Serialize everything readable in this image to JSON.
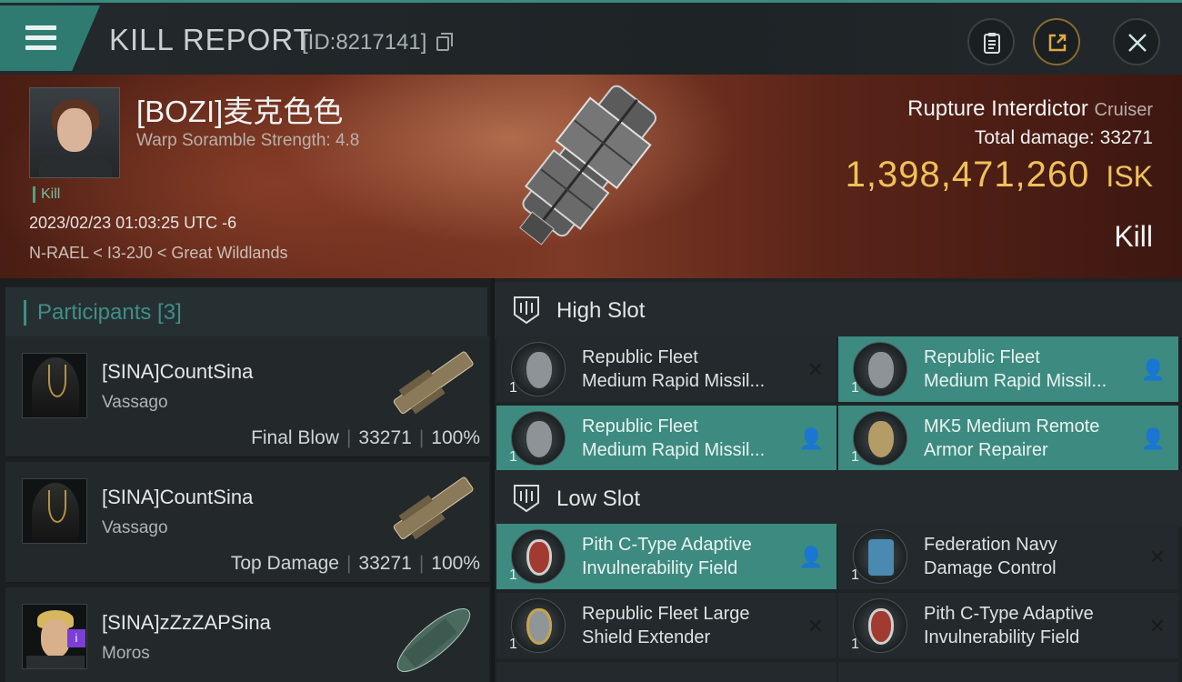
{
  "header": {
    "title": "KILL REPORT",
    "report_id": "[ID:8217141]",
    "icons": [
      "menu-icon",
      "copy-icon",
      "clipboard-icon",
      "share-icon",
      "close-icon"
    ]
  },
  "victim": {
    "name": "[BOZI]麦克色色",
    "warp_scramble": "Warp Soramble Strength: 4.8",
    "tag": "Kill",
    "datetime": "2023/02/23 01:03:25 UTC -6",
    "location": "N-RAEL < I3-2J0 < Great Wildlands",
    "ship_name": "Rupture Interdictor",
    "ship_class": "Cruiser",
    "total_damage_label": "Total damage:",
    "total_damage": "33271",
    "isk_value": "1,398,471,260",
    "isk_unit": "ISK",
    "result": "Kill"
  },
  "participants": {
    "title": "Participants [3]",
    "list": [
      {
        "name": "[SINA]CountSina",
        "ship": "Vassago",
        "role": "Final Blow",
        "damage": "33271",
        "percent": "100%"
      },
      {
        "name": "[SINA]CountSina",
        "ship": "Vassago",
        "role": "Top Damage",
        "damage": "33271",
        "percent": "100%"
      },
      {
        "name": "[SINA]zZzZAPSina",
        "ship": "Moros",
        "role": "",
        "damage": "",
        "percent": ""
      }
    ]
  },
  "slots": {
    "high": {
      "title": "High Slot",
      "modules": [
        {
          "name": "Republic Fleet\nMedium Rapid Missil...",
          "qty": "1",
          "status": "destroyed",
          "flag_icon": "x-icon"
        },
        {
          "name": "Republic Fleet\nMedium Rapid Missil...",
          "qty": "1",
          "status": "dropped",
          "flag_icon": "person-icon"
        },
        {
          "name": "Republic Fleet\nMedium Rapid Missil...",
          "qty": "1",
          "status": "dropped",
          "flag_icon": "person-icon"
        },
        {
          "name": "MK5 Medium Remote\nArmor Repairer",
          "qty": "1",
          "status": "dropped",
          "flag_icon": "person-icon"
        }
      ]
    },
    "low": {
      "title": "Low Slot",
      "modules": [
        {
          "name": "Pith C-Type Adaptive\nInvulnerability Field",
          "qty": "1",
          "status": "dropped",
          "flag_icon": "person-icon"
        },
        {
          "name": "Federation Navy\nDamage Control",
          "qty": "1",
          "status": "destroyed",
          "flag_icon": "x-icon"
        },
        {
          "name": "Republic Fleet Large\nShield Extender",
          "qty": "1",
          "status": "destroyed",
          "flag_icon": "x-icon"
        },
        {
          "name": "Pith C-Type Adaptive\nInvulnerability Field",
          "qty": "1",
          "status": "destroyed",
          "flag_icon": "x-icon"
        }
      ]
    }
  },
  "colors": {
    "accent_teal": "#3d8a80",
    "isk_gold": "#f0c15a",
    "hero_red": "#6a2c1c"
  }
}
